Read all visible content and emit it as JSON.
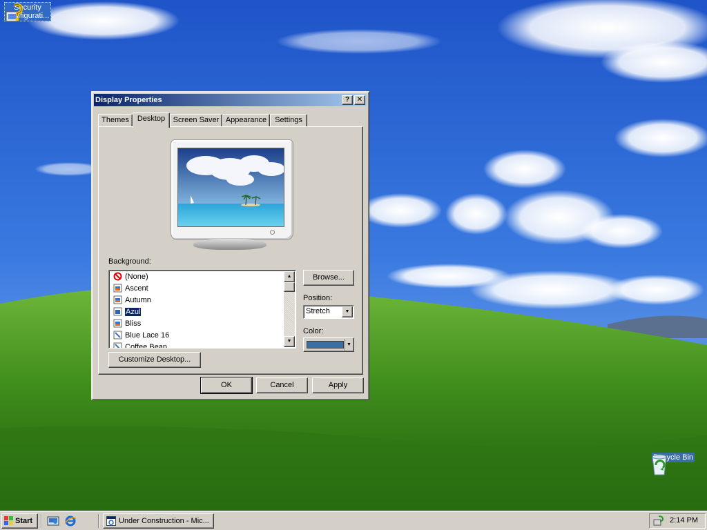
{
  "desktop": {
    "icons": [
      {
        "label": "Security\nConfigurati...",
        "icon": "security-config-icon"
      },
      {
        "label": "Recycle Bin",
        "icon": "recycle-bin-icon"
      }
    ]
  },
  "dialog": {
    "title": "Display Properties",
    "help_button": "?",
    "close_button": "✕",
    "tabs": [
      "Themes",
      "Desktop",
      "Screen Saver",
      "Appearance",
      "Settings"
    ],
    "active_tab": "Desktop",
    "background_label": "Background:",
    "background_items": [
      {
        "label": "(None)",
        "icon": "none-icon"
      },
      {
        "label": "Ascent",
        "icon": "image-file-icon"
      },
      {
        "label": "Autumn",
        "icon": "image-file-icon"
      },
      {
        "label": "Azul",
        "icon": "image-file-icon",
        "selected": true
      },
      {
        "label": "Bliss",
        "icon": "image-file-icon"
      },
      {
        "label": "Blue Lace 16",
        "icon": "bitmap-file-icon"
      },
      {
        "label": "Coffee Bean",
        "icon": "bitmap-file-icon"
      }
    ],
    "browse_button": "Browse...",
    "position_label": "Position:",
    "position_value": "Stretch",
    "color_label": "Color:",
    "color_value": "#3a6ea5",
    "customize_button": "Customize Desktop...",
    "ok_button": "OK",
    "cancel_button": "Cancel",
    "apply_button": "Apply"
  },
  "taskbar": {
    "start_label": "Start",
    "quick_launch": [
      "show-desktop-icon",
      "internet-explorer-icon"
    ],
    "window_button": "Under Construction - Mic...",
    "clock": "2:14 PM"
  }
}
